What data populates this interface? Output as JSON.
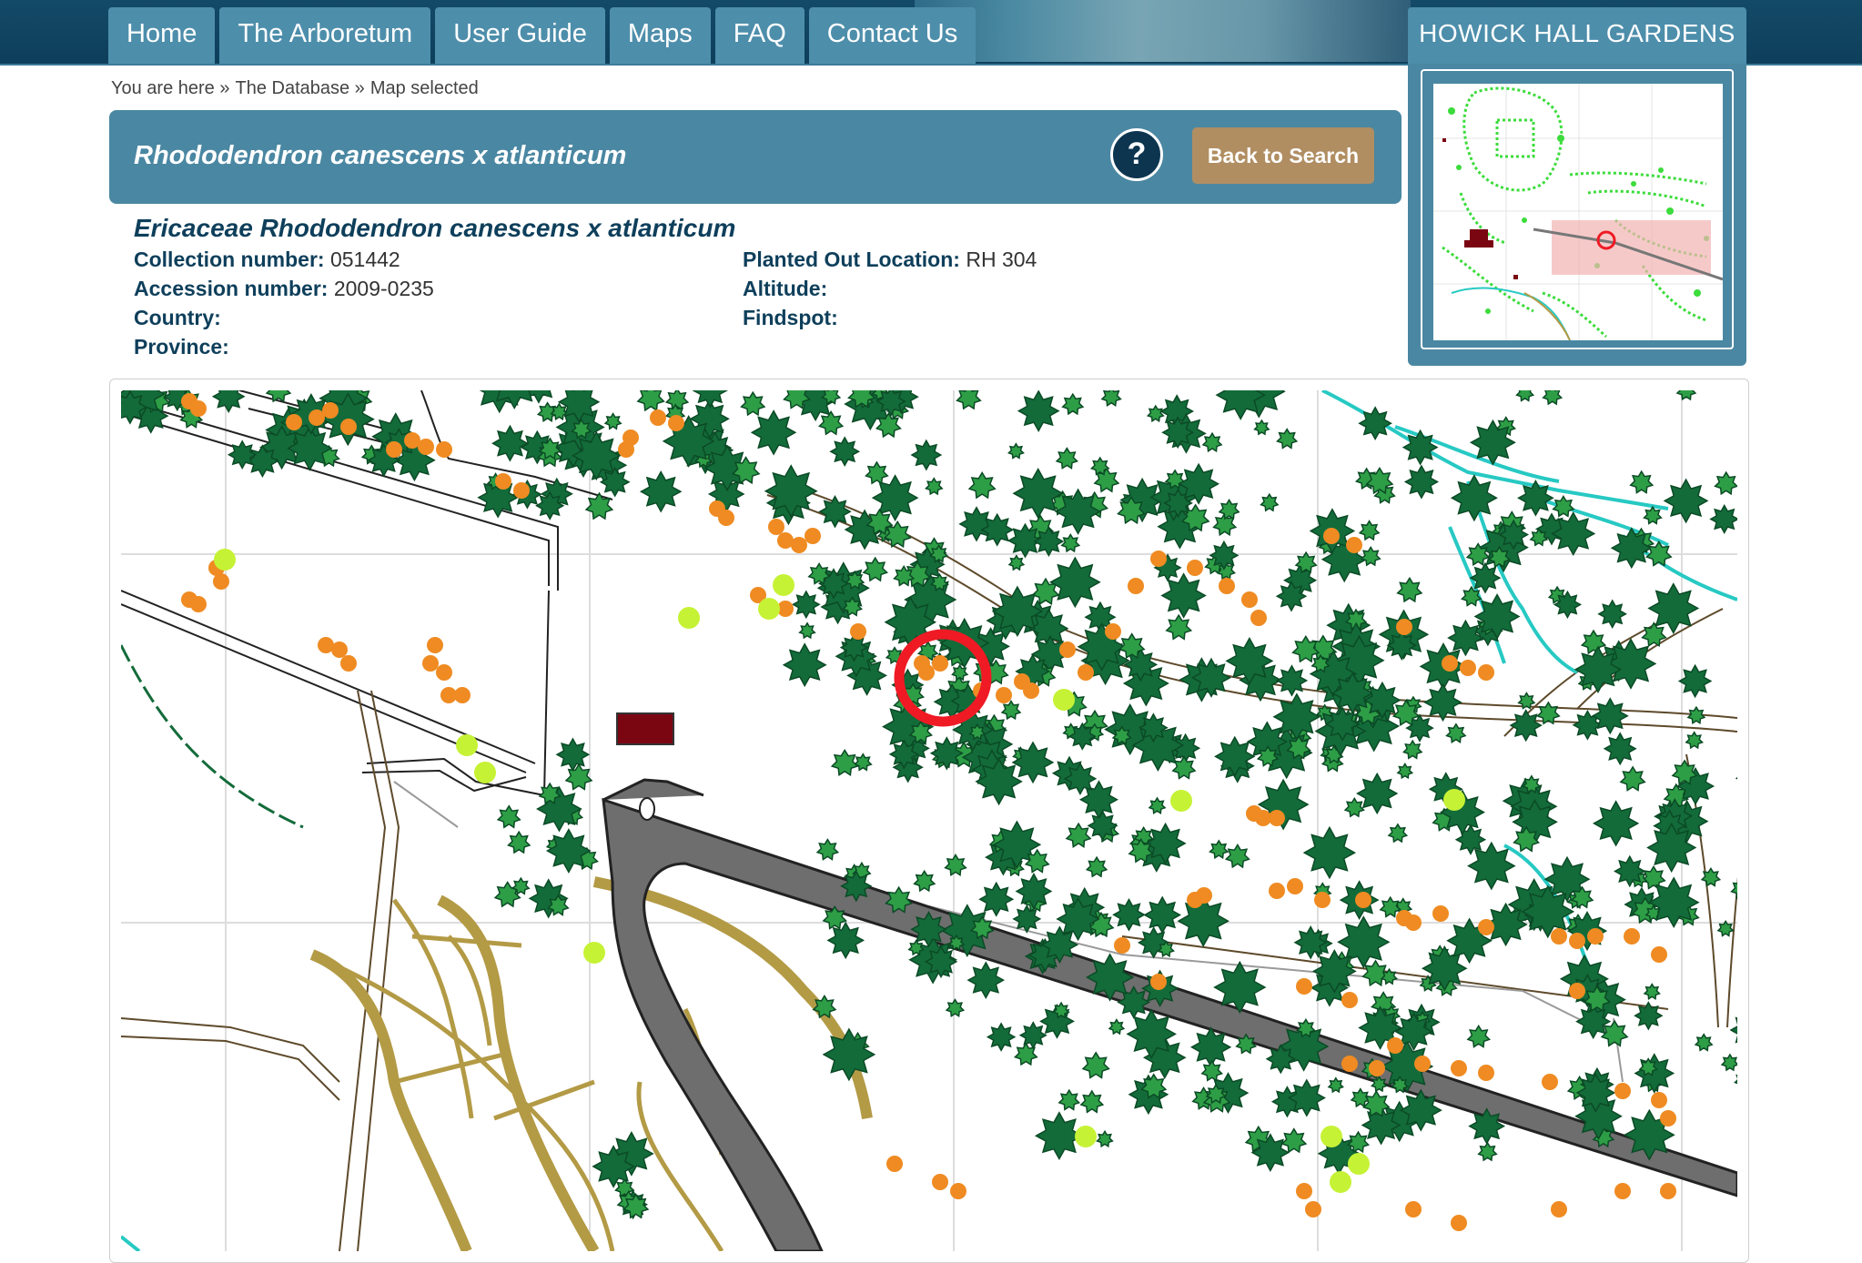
{
  "nav": {
    "items": [
      "Home",
      "The Arboretum",
      "User Guide",
      "Maps",
      "FAQ",
      "Contact Us"
    ]
  },
  "site_title": "HOWICK HALL GARDENS",
  "breadcrumb": {
    "prefix": "You are here »",
    "items": [
      "The Database »",
      "Map selected"
    ]
  },
  "header": {
    "title": "Rhododendron canescens x atlanticum",
    "help_label": "?",
    "back_label": "Back to Search"
  },
  "plant": {
    "full_name": "Ericaceae Rhododendron canescens x atlanticum",
    "collection_label": "Collection number:",
    "collection_value": "051442",
    "accession_label": "Accession number:",
    "accession_value": "2009-0235",
    "country_label": "Country:",
    "province_label": "Province:",
    "planted_label": "Planted Out Location:",
    "planted_value": "RH 304",
    "altitude_label": "Altitude:",
    "findspot_label": "Findspot:"
  },
  "colors": {
    "header_bg": "#134a68",
    "tab_bg": "#4d8eab",
    "panel_bg": "#4a87a2",
    "back_button_bg": "#b08e62",
    "help_button_bg": "#0d3550",
    "tree_dark": "#136b3a",
    "tree_light": "#2e9e46",
    "shrub_orange": "#ef8b22",
    "shrub_lime": "#c6f235",
    "path_gold": "#b39a45",
    "road_grey": "#6e6e6e",
    "stream_cyan": "#27c9c3",
    "building": "#7a0612",
    "marker_red": "#ef1a24"
  },
  "icons": {
    "help": "question-circle-icon",
    "marker": "selection-circle-icon"
  }
}
